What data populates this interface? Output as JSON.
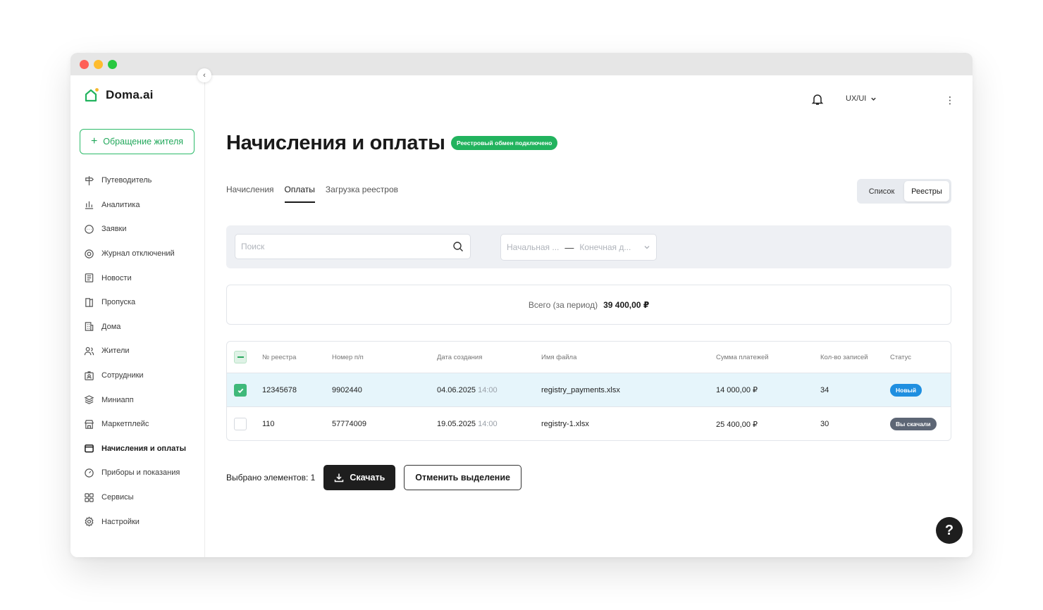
{
  "app": {
    "logo_text": "Doma.ai"
  },
  "sidebar": {
    "appeal_button": "Обращение жителя",
    "items": [
      {
        "label": "Путеводитель",
        "icon": "signpost-icon"
      },
      {
        "label": "Аналитика",
        "icon": "bar-chart-icon"
      },
      {
        "label": "Заявки",
        "icon": "chat-icon"
      },
      {
        "label": "Журнал отключений",
        "icon": "power-log-icon"
      },
      {
        "label": "Новости",
        "icon": "newspaper-icon"
      },
      {
        "label": "Пропуска",
        "icon": "pass-icon"
      },
      {
        "label": "Дома",
        "icon": "building-icon"
      },
      {
        "label": "Жители",
        "icon": "users-icon"
      },
      {
        "label": "Сотрудники",
        "icon": "badge-icon"
      },
      {
        "label": "Миниапп",
        "icon": "layers-icon"
      },
      {
        "label": "Маркетплейс",
        "icon": "store-icon"
      },
      {
        "label": "Начисления и оплаты",
        "icon": "wallet-icon",
        "active": true
      },
      {
        "label": "Приборы и показания",
        "icon": "meter-icon"
      },
      {
        "label": "Сервисы",
        "icon": "grid-icon"
      },
      {
        "label": "Настройки",
        "icon": "gear-icon"
      }
    ]
  },
  "header": {
    "user_label": "UX/UI"
  },
  "page": {
    "title": "Начисления и оплаты",
    "badge": "Реестровый обмен подключено"
  },
  "tabs": [
    {
      "label": "Начисления",
      "active": false
    },
    {
      "label": "Оплаты",
      "active": true
    },
    {
      "label": "Загрузка реестров",
      "active": false
    }
  ],
  "view_toggle": {
    "list": "Список",
    "registries": "Реестры"
  },
  "filters": {
    "search_placeholder": "Поиск",
    "date_start_placeholder": "Начальная ...",
    "date_end_placeholder": "Конечная д..."
  },
  "total": {
    "label": "Всего (за период)",
    "value": "39 400,00 ₽"
  },
  "table": {
    "columns": [
      "№ реестра",
      "Номер п/п",
      "Дата создания",
      "Имя файла",
      "Сумма платежей",
      "Кол-во записей",
      "Статус"
    ],
    "rows": [
      {
        "registry": "12345678",
        "number": "9902440",
        "date": "04.06.2025",
        "time": "14:00",
        "file": "registry_payments.xlsx",
        "sum": "14 000,00 ₽",
        "count": "34",
        "status": "Новый",
        "checked": true
      },
      {
        "registry": "110",
        "number": "57774009",
        "date": "19.05.2025",
        "time": "14:00",
        "file": "registry-1.xlsx",
        "sum": "25 400,00 ₽",
        "count": "30",
        "status": "Вы скачали",
        "checked": false
      }
    ]
  },
  "selection": {
    "label": "Выбрано элементов: 1",
    "download": "Скачать",
    "cancel": "Отменить выделение"
  },
  "help": {
    "label": "?"
  },
  "colors": {
    "accent": "#22b35e",
    "dark": "#1e1e1e",
    "status_new": "#1f8fe0",
    "status_done": "#5d6675"
  }
}
